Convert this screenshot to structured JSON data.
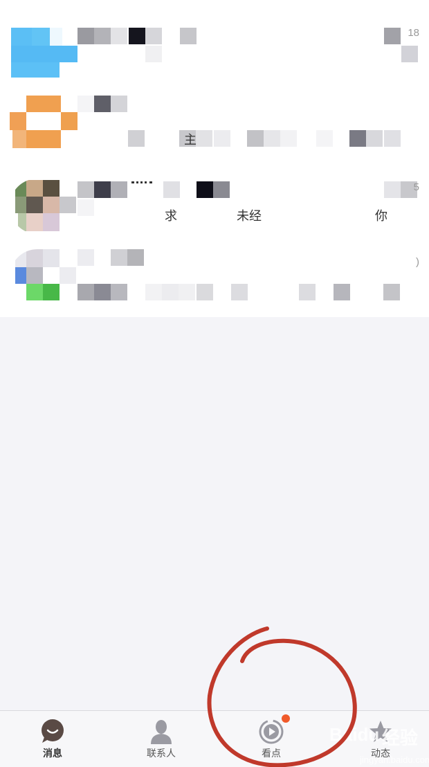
{
  "chat_list": {
    "items": [
      {
        "time": "18",
        "fragments": []
      },
      {
        "time": "",
        "fragments": [
          "主"
        ]
      },
      {
        "time": "5",
        "fragments": [
          "求",
          "未经",
          "你"
        ]
      },
      {
        "time": ")",
        "fragments": []
      }
    ]
  },
  "tabbar": {
    "tabs": [
      {
        "label": "消息",
        "icon": "chat-bubble-icon",
        "active": true
      },
      {
        "label": "联系人",
        "icon": "contact-person-icon",
        "active": false
      },
      {
        "label": "看点",
        "icon": "play-circle-icon",
        "active": false,
        "badge": true
      },
      {
        "label": "动态",
        "icon": "star-icon",
        "active": false
      }
    ]
  },
  "colors": {
    "annotation": "#c0392b",
    "badge": "#f05a2a",
    "active_icon": "#5a4a45",
    "inactive_icon": "#9a9aa2"
  },
  "watermark": {
    "brand": "Baidu",
    "text_cn": "经验",
    "url": "jingyan.baidu.com"
  }
}
